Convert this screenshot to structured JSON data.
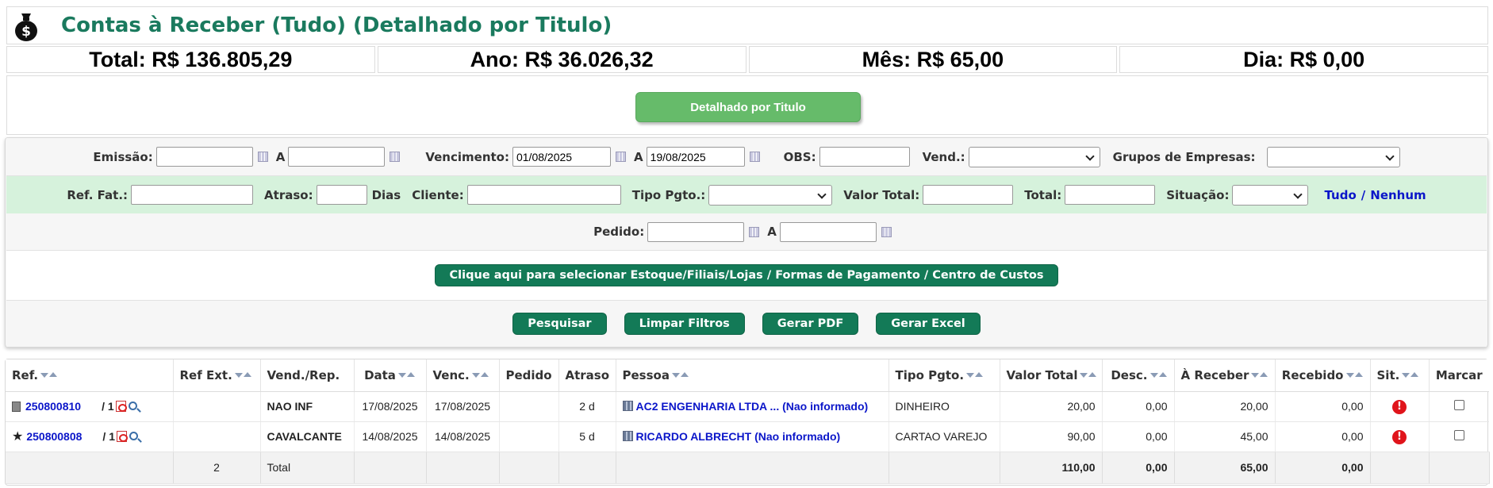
{
  "header": {
    "title": "Contas à Receber (Tudo) (Detalhado por Titulo)",
    "icon": "money-bag-icon"
  },
  "totals": {
    "total": "Total: R$ 136.805,29",
    "ano": "Ano: R$ 36.026,32",
    "mes": "Mês: R$ 65,00",
    "dia": "Dia: R$ 0,00"
  },
  "view_button": "Detalhado por Titulo",
  "filters": {
    "emissao_label": "Emissão:",
    "emissao_from": "",
    "a_label": "A",
    "emissao_to": "",
    "vencimento_label": "Vencimento:",
    "vencimento_from": "01/08/2025",
    "vencimento_to": "19/08/2025",
    "obs_label": "OBS:",
    "vend_label": "Vend.:",
    "grupos_label": "Grupos de Empresas:",
    "ref_fat_label": "Ref. Fat.:",
    "atraso_label": "Atraso:",
    "dias_label": "Dias",
    "cliente_label": "Cliente:",
    "tipo_pgto_label": "Tipo Pgto.:",
    "valor_total_label": "Valor Total:",
    "total_label": "Total:",
    "situacao_label": "Situação:",
    "tudo_link": "Tudo",
    "slash": "/",
    "nenhum_link": "Nenhum",
    "pedido_label": "Pedido:"
  },
  "select_button": "Clique aqui para selecionar Estoque/Filiais/Lojas / Formas de Pagamento / Centro de Custos",
  "actions": {
    "pesquisar": "Pesquisar",
    "limpar": "Limpar Filtros",
    "pdf": "Gerar PDF",
    "excel": "Gerar Excel"
  },
  "table": {
    "headers": {
      "ref": "Ref.",
      "ref_ext": "Ref Ext.",
      "vend": "Vend./Rep.",
      "data": "Data",
      "venc": "Venc.",
      "pedido": "Pedido",
      "atraso": "Atraso",
      "pessoa": "Pessoa",
      "tipo": "Tipo Pgto.",
      "valor_total": "Valor Total",
      "desc": "Desc.",
      "a_receber": "À Receber",
      "recebido": "Recebido",
      "sit": "Sit.",
      "marcar": "Marcar"
    },
    "rows": [
      {
        "icon": "document-icon",
        "ref": "250800810",
        "parcela": "/ 1",
        "ref_ext": "",
        "vend": "NAO INF",
        "data": "17/08/2025",
        "venc": "17/08/2025",
        "pedido": "",
        "atraso": "2 d",
        "pessoa": "AC2 ENGENHARIA LTDA ... (Nao informado)",
        "tipo": "DINHEIRO",
        "valor_total": "20,00",
        "desc": "0,00",
        "a_receber": "20,00",
        "recebido": "0,00",
        "sit": "!"
      },
      {
        "icon": "star-icon",
        "ref": "250800808",
        "parcela": "/ 1",
        "ref_ext": "",
        "vend": "CAVALCANTE",
        "data": "14/08/2025",
        "venc": "14/08/2025",
        "pedido": "",
        "atraso": "5 d",
        "pessoa": "RICARDO ALBRECHT (Nao informado)",
        "tipo": "CARTAO VAREJO",
        "valor_total": "90,00",
        "desc": "0,00",
        "a_receber": "45,00",
        "recebido": "0,00",
        "sit": "!"
      }
    ],
    "total_row": {
      "count": "2",
      "label": "Total",
      "valor_total": "110,00",
      "desc": "0,00",
      "a_receber": "65,00",
      "recebido": "0,00"
    }
  },
  "colors": {
    "title_green": "#1a7a5e",
    "button_green": "#137a57",
    "view_button_green": "#66bb6a",
    "filter_row_green": "#d6f2dc",
    "link_blue": "#0b16c9",
    "alert_red": "#e0141b"
  }
}
